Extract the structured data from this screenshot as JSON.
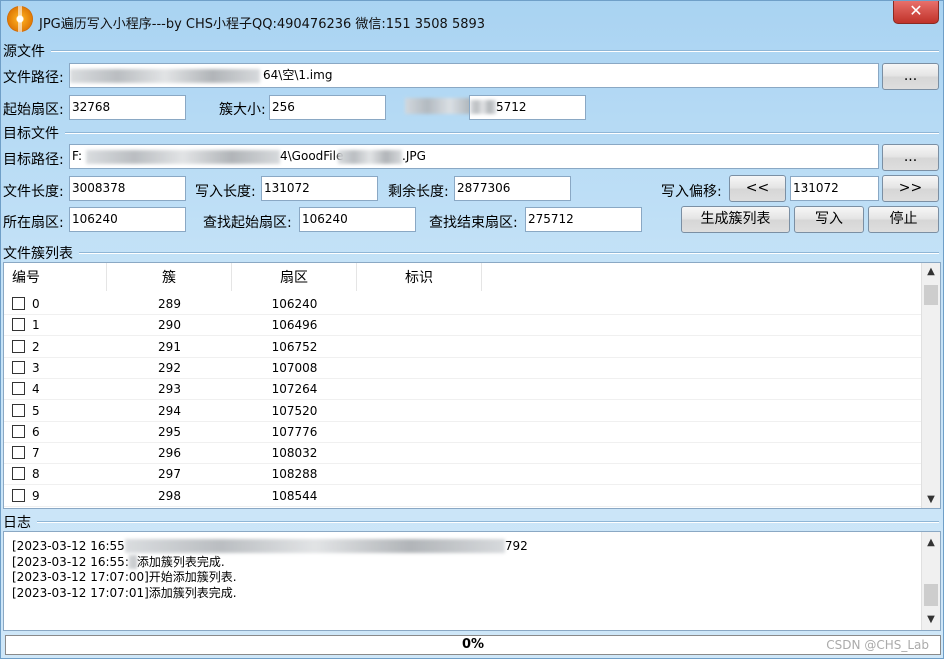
{
  "window": {
    "title": "JPG遍历写入小程序---by CHS小程子QQ:490476236 微信:151 3508 5893",
    "close_glyph": "✕"
  },
  "source": {
    "section_title": "源文件",
    "path_label": "文件路径:",
    "path_value": "64\\空\\1.img",
    "browse_label": "...",
    "start_sector_label": "起始扇区:",
    "start_sector_value": "32768",
    "cluster_size_label": "簇大小:",
    "cluster_size_value": "256",
    "third_value": "5712"
  },
  "target": {
    "section_title": "目标文件",
    "path_label": "目标路径:",
    "path_prefix": "F:",
    "path_mid": "4\\GoodFile",
    "path_suffix": ".JPG",
    "browse_label": "...",
    "file_length_label": "文件长度:",
    "file_length_value": "3008378",
    "write_length_label": "写入长度:",
    "write_length_value": "131072",
    "remaining_length_label": "剩余长度:",
    "remaining_length_value": "2877306",
    "write_offset_label": "写入偏移:",
    "prev_label": "<<",
    "write_offset_value": "131072",
    "next_label": ">>",
    "sector_label": "所在扇区:",
    "sector_value": "106240",
    "search_start_label": "查找起始扇区:",
    "search_start_value": "106240",
    "search_end_label": "查找结束扇区:",
    "search_end_value": "275712",
    "gen_list_label": "生成簇列表",
    "write_label": "写入",
    "stop_label": "停止"
  },
  "cluster_list": {
    "section_title": "文件簇列表",
    "columns": [
      "编号",
      "簇",
      "扇区",
      "标识"
    ],
    "rows": [
      {
        "id": "0",
        "cluster": "289",
        "sector": "106240",
        "flag": ""
      },
      {
        "id": "1",
        "cluster": "290",
        "sector": "106496",
        "flag": ""
      },
      {
        "id": "2",
        "cluster": "291",
        "sector": "106752",
        "flag": ""
      },
      {
        "id": "3",
        "cluster": "292",
        "sector": "107008",
        "flag": ""
      },
      {
        "id": "4",
        "cluster": "293",
        "sector": "107264",
        "flag": ""
      },
      {
        "id": "5",
        "cluster": "294",
        "sector": "107520",
        "flag": ""
      },
      {
        "id": "6",
        "cluster": "295",
        "sector": "107776",
        "flag": ""
      },
      {
        "id": "7",
        "cluster": "296",
        "sector": "108032",
        "flag": ""
      },
      {
        "id": "8",
        "cluster": "297",
        "sector": "108288",
        "flag": ""
      },
      {
        "id": "9",
        "cluster": "298",
        "sector": "108544",
        "flag": ""
      }
    ]
  },
  "log": {
    "section_title": "日志",
    "lines": [
      "[2023-03-12 16:55",
      "[2023-03-12 16:55:",
      "[2023-03-12 17:07:00]开始添加簇列表.",
      "[2023-03-12 17:07:01]添加簇列表完成."
    ],
    "line0_tail": "792",
    "line1_tail": "添加簇列表完成."
  },
  "progress": {
    "label": "0%",
    "value": 0
  },
  "watermark": "CSDN @CHS_Lab"
}
